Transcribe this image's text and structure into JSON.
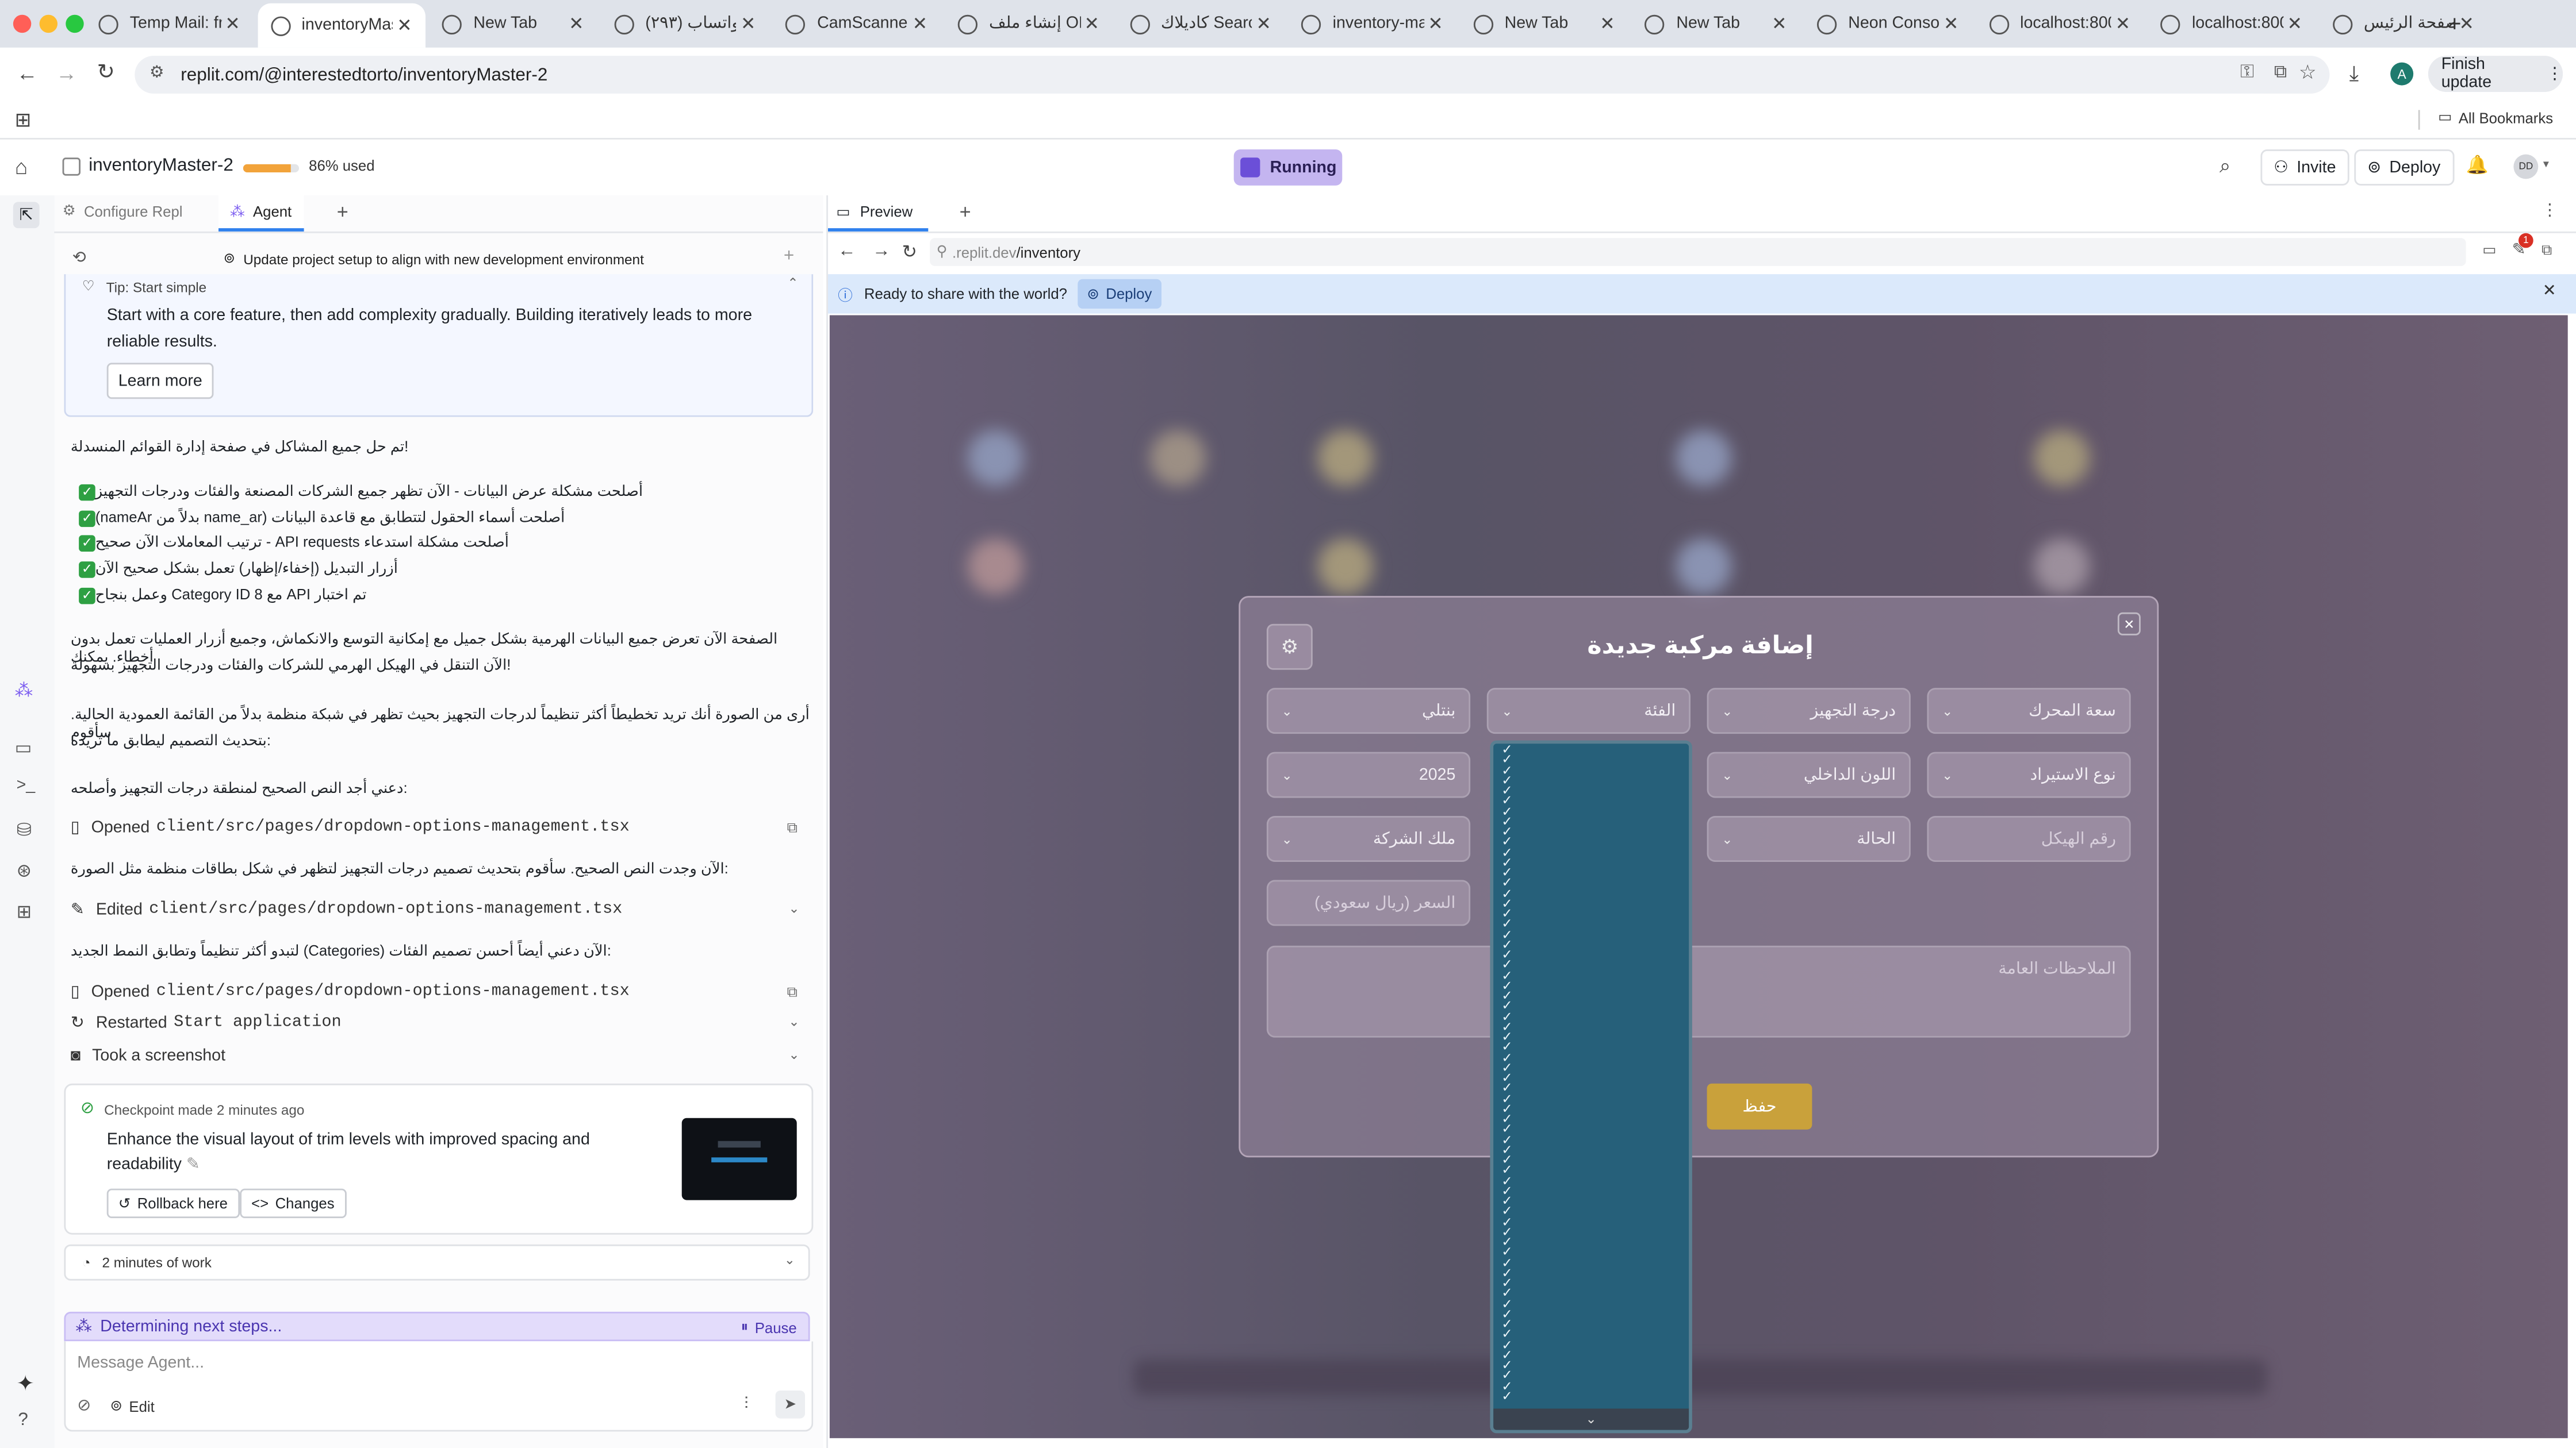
{
  "browser": {
    "tabs": [
      {
        "title": "Temp Mail: fre",
        "active": false
      },
      {
        "title": "inventoryMas",
        "active": true
      },
      {
        "title": "New Tab",
        "active": false
      },
      {
        "title": "(٢٩٣) واتساب",
        "active": false
      },
      {
        "title": "CamScanner",
        "active": false
      },
      {
        "title": "إنشاء ملف ON",
        "active": false
      },
      {
        "title": "كاديلاك Search",
        "active": false
      },
      {
        "title": "inventory-ma",
        "active": false
      },
      {
        "title": "New Tab",
        "active": false
      },
      {
        "title": "New Tab",
        "active": false
      },
      {
        "title": "Neon Consol",
        "active": false
      },
      {
        "title": "localhost:800",
        "active": false
      },
      {
        "title": "localhost:800",
        "active": false
      },
      {
        "title": "الصفحة الرئيس",
        "active": false
      }
    ],
    "url": "replit.com/@interestedtorto/inventoryMaster-2",
    "finish_update": "Finish update",
    "all_bookmarks": "All Bookmarks",
    "profile_initial": "A"
  },
  "replit": {
    "project_name": "inventoryMaster-2",
    "usage": "86% used",
    "usage_fraction": 0.86,
    "run_state": "Running",
    "invite": "Invite",
    "deploy": "Deploy",
    "avatar": "DD",
    "left_tabs": {
      "configure": "Configure Repl",
      "agent": "Agent"
    },
    "task_title": "Update project setup to align with new development environment",
    "tip": {
      "label": "Tip: Start simple",
      "body": "Start with a core feature, then add complexity gradually. Building iteratively leads to more reliable results.",
      "learn_more": "Learn more"
    },
    "chat": {
      "p1": "!تم حل جميع المشاكل في صفحة إدارة القوائم المنسدلة",
      "checks": [
        "أصلحت مشكلة عرض البيانات - الآن تظهر جميع الشركات المصنعة والفئات ودرجات التجهيز",
        "أصلحت أسماء الحقول لتتطابق مع قاعدة البيانات (name_ar بدلاً من nameAr)",
        "أصلحت مشكلة استدعاء API requests - ترتيب المعاملات الآن صحيح",
        "أزرار التبديل (إخفاء/إظهار) تعمل بشكل صحيح الآن",
        "تم اختبار API مع Category ID 8 وعمل بنجاح"
      ],
      "p2a": "الصفحة الآن تعرض جميع البيانات الهرمية بشكل جميل مع إمكانية التوسع والانكماش، وجميع أزرار العمليات تعمل بدون أخطاء. يمكنك",
      "p2b": "!الآن التنقل في الهيكل الهرمي للشركات والفئات ودرجات التجهيز بسهولة",
      "p3a": "أرى من الصورة أنك تريد تخطيطاً أكثر تنظيماً لدرجات التجهيز بحيث تظهر في شبكة منظمة بدلاً من القائمة العمودية الحالية. سأقوم",
      "p3b": ":بتحديث التصميم ليطابق ما تريده",
      "p4": ":دعني أجد النص الصحيح لمنطقة درجات التجهيز وأصلحه",
      "act1_verb": "Opened",
      "act1_file": "client/src/pages/dropdown-options-management.tsx",
      "p5": ":الآن وجدت النص الصحيح. سأقوم بتحديث تصميم درجات التجهيز لتظهر في شكل بطاقات منظمة مثل الصورة",
      "act2_verb": "Edited",
      "act2_file": "client/src/pages/dropdown-options-management.tsx",
      "p6": ":الآن دعني أيضاً أحسن تصميم الفئات (Categories) لتبدو أكثر تنظيماً وتطابق النمط الجديد",
      "act3_verb": "Opened",
      "act3_file": "client/src/pages/dropdown-options-management.tsx",
      "act4_verb": "Restarted",
      "act4_target": "Start application",
      "act5": "Took a screenshot"
    },
    "checkpoint": {
      "meta": "Checkpoint made 2 minutes ago",
      "title": "Enhance the visual layout of trim levels with improved spacing and readability",
      "rollback": "Rollback here",
      "changes": "Changes"
    },
    "work_time": "2 minutes of work",
    "status": "Determining next steps...",
    "pause": "Pause",
    "message_placeholder": "Message Agent...",
    "edit": "Edit",
    "preview": {
      "tab": "Preview",
      "url_prefix": ".replit.dev",
      "url_path": "/inventory",
      "banner": "Ready to share with the world?",
      "banner_deploy": "Deploy",
      "notif_count": "1"
    }
  },
  "modal": {
    "title": "إضافة مركبة جديدة",
    "fields": {
      "engine": "سعة المحرك",
      "trim": "درجة التجهيز",
      "category": "الفئة",
      "brand": "بنتلي",
      "import_type": "نوع الاستيراد",
      "interior": "اللون الداخلي",
      "year": "2025",
      "chassis": "رقم الهيكل",
      "status": "الحالة",
      "ownership": "ملك الشركة",
      "price": "السعر (ريال سعودي)",
      "notes": "الملاحظات العامة"
    },
    "save": "حفظ",
    "dropdown_check_count": 64
  }
}
